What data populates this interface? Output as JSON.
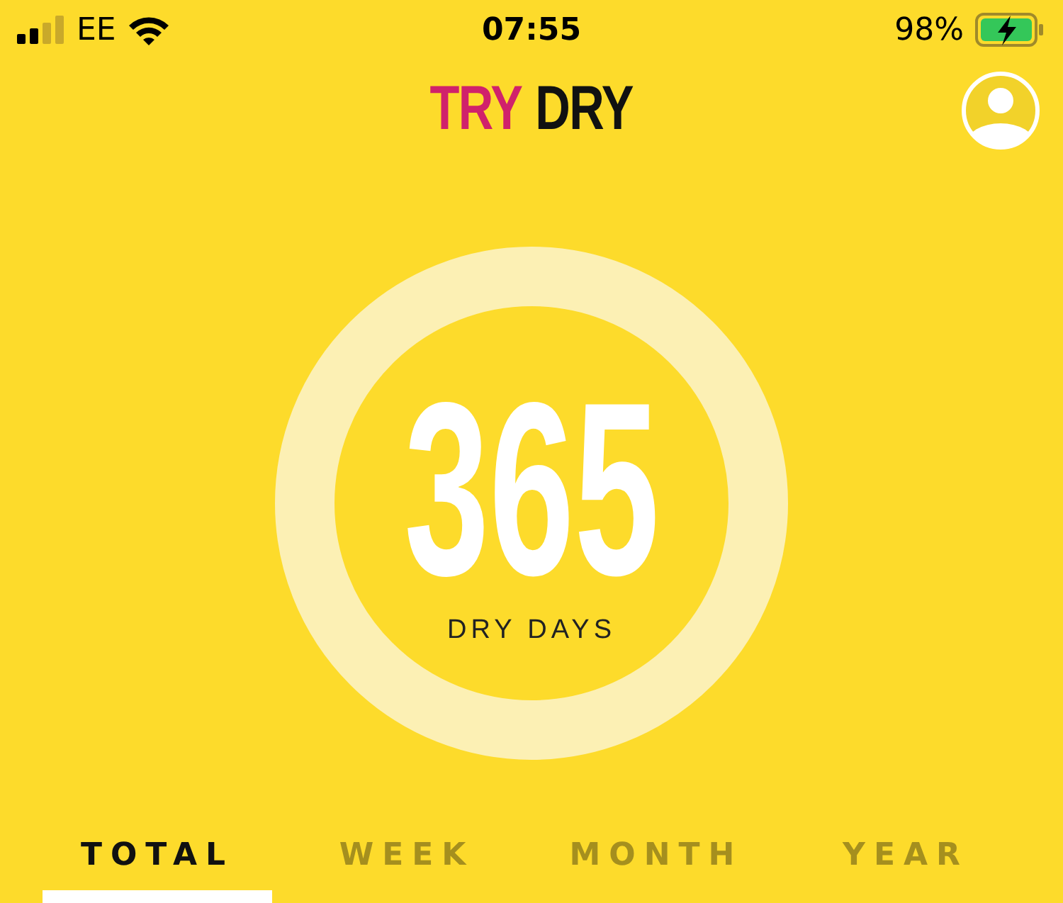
{
  "status_bar": {
    "carrier": "EE",
    "time": "07:55",
    "battery": "98%"
  },
  "header": {
    "logo_first": "TRY",
    "logo_second": "DRY"
  },
  "counter": {
    "value": "365",
    "label": "DRY DAYS"
  },
  "tabs": [
    {
      "label": "TOTAL",
      "selected": true
    },
    {
      "label": "WEEK",
      "selected": false
    },
    {
      "label": "MONTH",
      "selected": false
    },
    {
      "label": "YEAR",
      "selected": false
    }
  ]
}
